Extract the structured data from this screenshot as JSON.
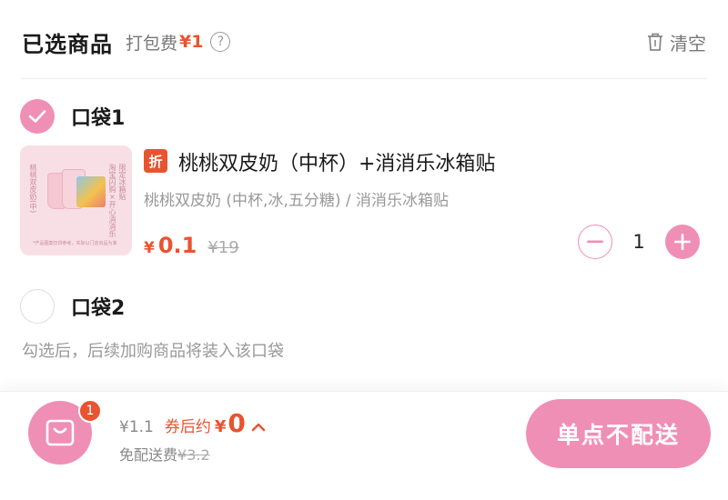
{
  "header": {
    "title": "已选商品",
    "fee_label": "打包费",
    "fee_value": "¥1",
    "help_glyph": "?",
    "clear_label": "清空"
  },
  "bags": [
    {
      "label": "口袋1",
      "checked": true
    },
    {
      "label": "口袋2",
      "checked": false
    }
  ],
  "product": {
    "tag": "折",
    "name": "桃桃双皮奶（中杯）+消消乐冰箱贴",
    "spec": "桃桃双皮奶 (中杯,冰,五分糖) / 消消乐冰箱贴",
    "currency": "¥",
    "price": "0.1",
    "original_price": "¥19",
    "quantity": "1",
    "thumb_text_left": "桃桃双皮奶(中)",
    "thumb_text_right": "淘宝闪购×开心消消乐",
    "thumb_text_far": "限定冰箱贴",
    "thumb_footer": "*产品图案仅供参考，实际以门店出品为准"
  },
  "hint": "勾选后，后续加购商品将装入该口袋",
  "footer": {
    "badge_count": "1",
    "subtotal": "¥1.1",
    "after_coupon_label": "券后约",
    "currency": "¥",
    "after_coupon_value": "0",
    "delivery_label": "免配送费",
    "delivery_original": "¥3.2",
    "cta_label": "单点不配送"
  },
  "colors": {
    "accent_pink": "#f08fb6",
    "price_orange": "#e8542f"
  },
  "icons": [
    "help-icon",
    "trash-icon",
    "check-icon",
    "minus-icon",
    "plus-icon",
    "shopping-bag-icon",
    "chevron-up-icon"
  ]
}
